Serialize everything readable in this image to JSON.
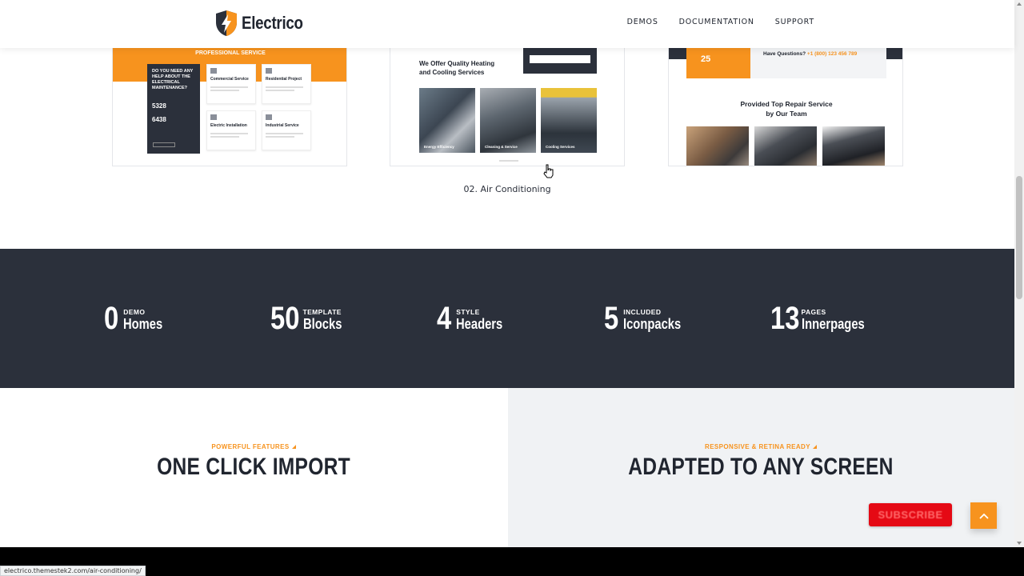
{
  "header": {
    "logo_text": "Electrico",
    "nav": [
      "DEMOS",
      "DOCUMENTATION",
      "SUPPORT"
    ]
  },
  "demos": {
    "demo1": {
      "strip_title": "PROFESSIONAL SERVICE",
      "question": "DO YOU NEED ANY HELP ABOUT THE ELECTRICAL MAINTENANCE?",
      "count1": "5328",
      "count2": "6438",
      "cards": [
        "Commercial Service",
        "Residential Project",
        "Electric Installation",
        "Industrial Service"
      ]
    },
    "demo2": {
      "title_line1": "We Offer Quality Heating",
      "title_line2": "and Cooling Services",
      "tiles": [
        "Energy Efficiency",
        "Cleaning & Service",
        "Cooling Services"
      ],
      "caption": "02. Air Conditioning"
    },
    "demo3": {
      "experience_number": "25",
      "question_label": "Have Questions?",
      "phone": "+1 (800) 123 456 789",
      "title_line1": "Provided Top Repair Service",
      "title_line2": "by Our Team"
    }
  },
  "stats": [
    {
      "number": "0",
      "small": "DEMO",
      "big": "Homes"
    },
    {
      "number": "50",
      "small": "TEMPLATE",
      "big": "Blocks"
    },
    {
      "number": "4",
      "small": "STYLE",
      "big": "Headers"
    },
    {
      "number": "5",
      "small": "INCLUDED",
      "big": "Iconpacks"
    },
    {
      "number": "13",
      "small": "PAGES",
      "big": "Innerpages"
    }
  ],
  "features": {
    "left": {
      "subtitle": "POWERFUL FEATURES",
      "title": "ONE CLICK IMPORT"
    },
    "right": {
      "subtitle": "RESPONSIVE & RETINA READY",
      "title": "ADAPTED TO ANY SCREEN"
    }
  },
  "floating": {
    "subscribe_label": "SUBSCRIBE"
  },
  "status_bar": {
    "url": "electrico.themestek2.com/air-conditioning/"
  },
  "colors": {
    "accent": "#f7931e",
    "dark": "#2b303b",
    "subscribe": "#e50914",
    "light_bg": "#f0f2f4"
  },
  "icons": [
    "logo-bolt-shield-icon",
    "arrow-up-icon",
    "hand-cursor-icon"
  ]
}
